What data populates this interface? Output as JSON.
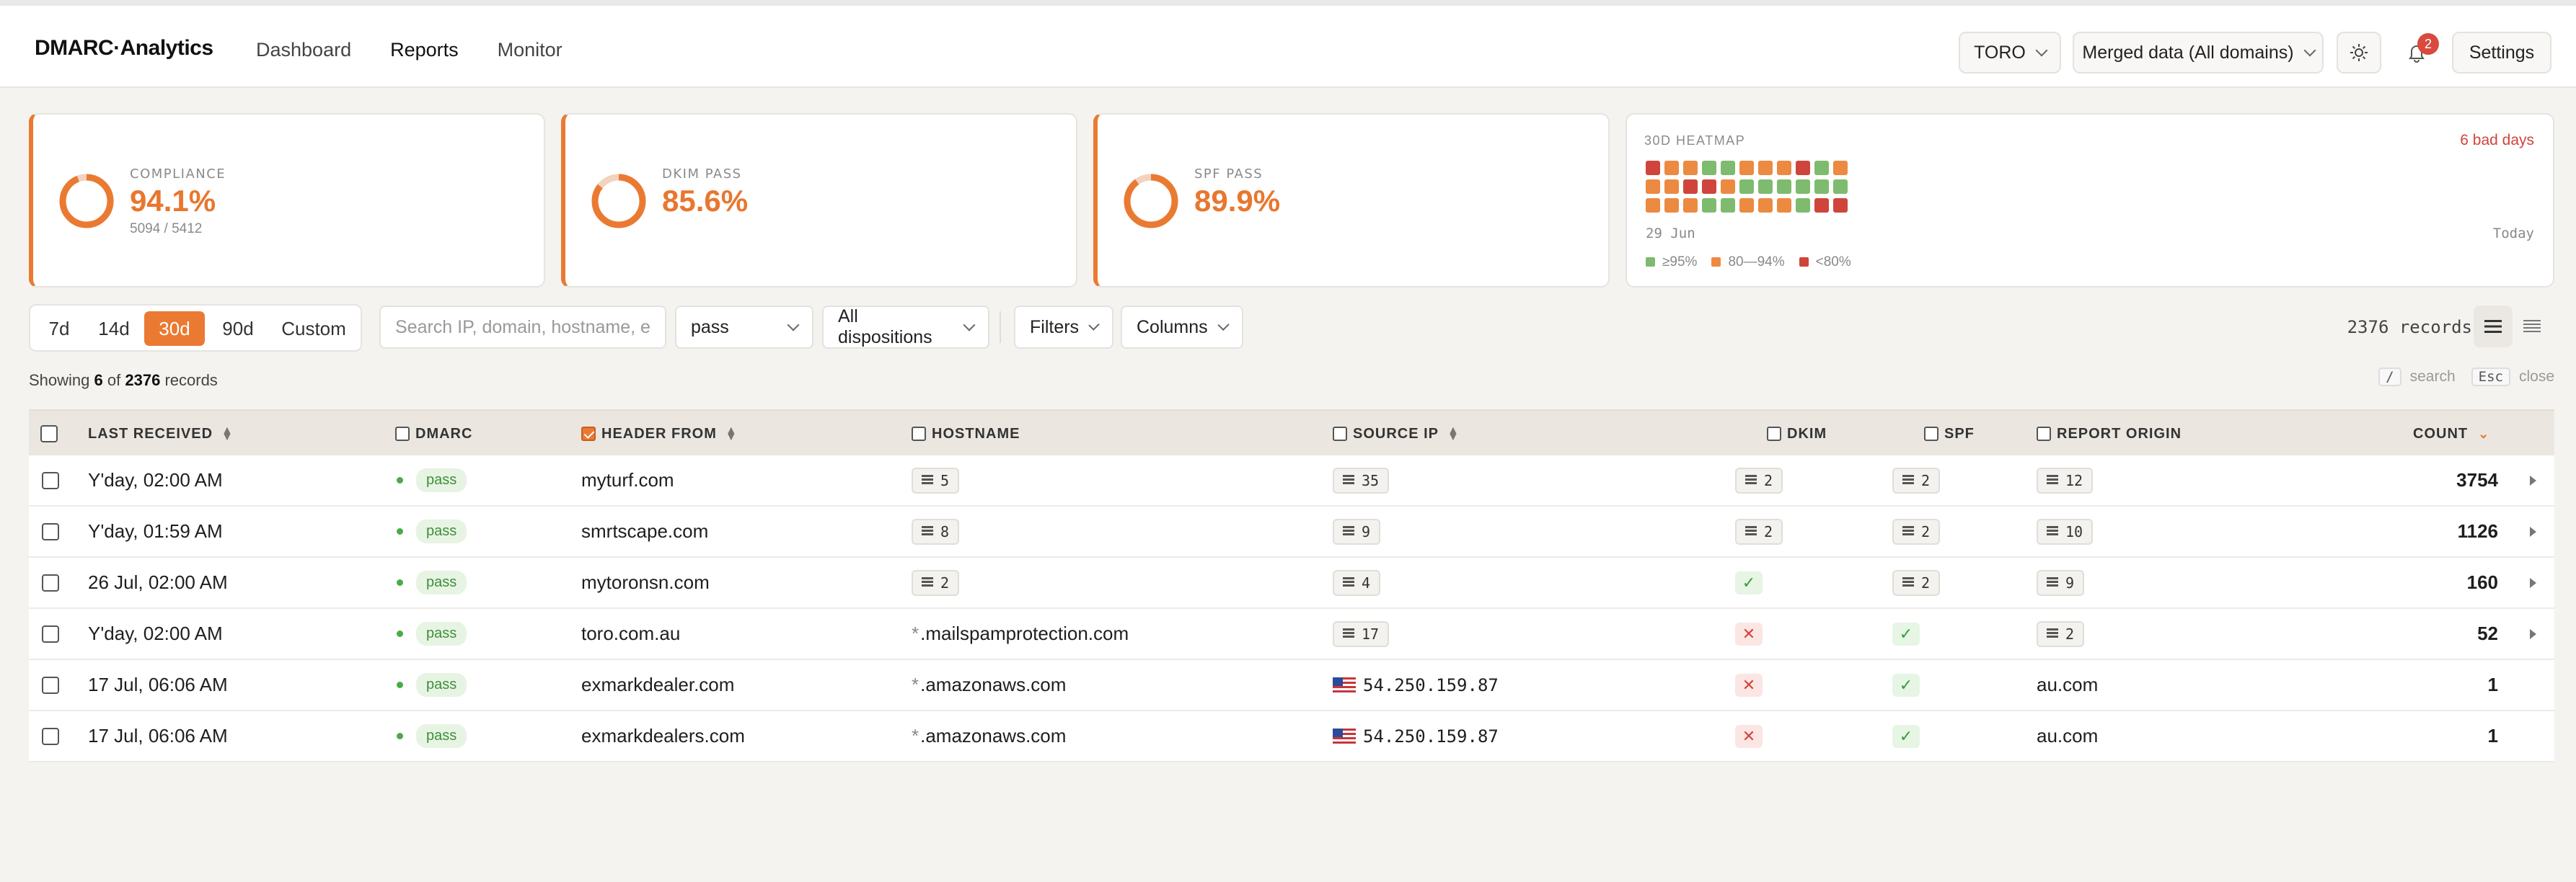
{
  "app": {
    "brand": "DMARC·Analytics"
  },
  "nav": [
    {
      "label": "Dashboard"
    },
    {
      "label": "Reports"
    },
    {
      "label": "Monitor"
    }
  ],
  "topbar": {
    "org_select": "TORO",
    "data_select": "Merged data (All domains)",
    "notif_count": "2",
    "settings_label": "Settings"
  },
  "kpis": [
    {
      "label": "COMPLIANCE",
      "value": "94.1%",
      "sub": "5094 / 5412",
      "percent": 94.1
    },
    {
      "label": "DKIM PASS",
      "value": "85.6%",
      "sub": "",
      "percent": 85.6
    },
    {
      "label": "SPF PASS",
      "value": "89.9%",
      "sub": "",
      "percent": 89.9
    }
  ],
  "heatmap": {
    "title": "30D HEATMAP",
    "bad_days": "6 bad days",
    "start_label": "29 Jun",
    "end_label": "Today",
    "legend": [
      "≥95%",
      "80—94%",
      "<80%"
    ],
    "colors": {
      "good": "#7fbb6e",
      "mid": "#ec8a42",
      "bad": "#d0453b"
    },
    "rows": [
      [
        "bad",
        "mid",
        "mid",
        "good",
        "good",
        "mid",
        "mid",
        "mid",
        "bad",
        "good",
        "mid"
      ],
      [
        "mid",
        "mid",
        "bad",
        "bad",
        "mid",
        "good",
        "good",
        "good",
        "good",
        "good",
        "good"
      ],
      [
        "mid",
        "mid",
        "mid",
        "good",
        "good",
        "mid",
        "mid",
        "mid",
        "good",
        "bad",
        "bad"
      ]
    ]
  },
  "filters": {
    "ranges": [
      "7d",
      "14d",
      "30d",
      "90d",
      "Custom"
    ],
    "active_range": "30d",
    "search_placeholder": "Search IP, domain, hostname, e",
    "result_select": "pass",
    "disposition_select": "All dispositions",
    "filters_label": "Filters",
    "columns_label": "Columns",
    "records_label": "2376 records"
  },
  "summary": {
    "prefix": "Showing",
    "shown": "6",
    "mid": "of",
    "total": "2376",
    "suffix": "records",
    "hint_search_key": "/",
    "hint_search": "search",
    "hint_close_key": "Esc",
    "hint_close": "close"
  },
  "table": {
    "columns": {
      "last_received": "LAST RECEIVED",
      "dmarc": "DMARC",
      "header_from": "HEADER FROM",
      "hostname": "HOSTNAME",
      "source_ip": "SOURCE IP",
      "dkim": "DKIM",
      "spf": "SPF",
      "report_origin": "REPORT ORIGIN",
      "count": "COUNT"
    },
    "rows": [
      {
        "received": "Y'day, 02:00 AM",
        "dmarc": "pass",
        "from": "myturf.com",
        "hostname": {
          "kind": "chip",
          "text": "5"
        },
        "ip": {
          "kind": "chip",
          "text": "35"
        },
        "dkim": {
          "kind": "chip",
          "text": "2"
        },
        "spf": {
          "kind": "chip",
          "text": "2"
        },
        "origin": {
          "kind": "chip",
          "text": "12"
        },
        "count": "3754",
        "expand": true
      },
      {
        "received": "Y'day, 01:59 AM",
        "dmarc": "pass",
        "from": "smrtscape.com",
        "hostname": {
          "kind": "chip",
          "text": "8"
        },
        "ip": {
          "kind": "chip",
          "text": "9"
        },
        "dkim": {
          "kind": "chip",
          "text": "2"
        },
        "spf": {
          "kind": "chip",
          "text": "2"
        },
        "origin": {
          "kind": "chip",
          "text": "10"
        },
        "count": "1126",
        "expand": true
      },
      {
        "received": "26 Jul, 02:00 AM",
        "dmarc": "pass",
        "from": "mytoronsn.com",
        "hostname": {
          "kind": "chip",
          "text": "2"
        },
        "ip": {
          "kind": "chip",
          "text": "4"
        },
        "dkim": {
          "kind": "ok",
          "text": "✓"
        },
        "spf": {
          "kind": "chip",
          "text": "2"
        },
        "origin": {
          "kind": "chip",
          "text": "9"
        },
        "count": "160",
        "expand": true
      },
      {
        "received": "Y'day, 02:00 AM",
        "dmarc": "pass",
        "from": "toro.com.au",
        "hostname": {
          "kind": "wild",
          "star": "*",
          "text": ".mailspamprotection.com"
        },
        "ip": {
          "kind": "chip",
          "text": "17"
        },
        "dkim": {
          "kind": "fail",
          "text": "✕"
        },
        "spf": {
          "kind": "ok",
          "text": "✓"
        },
        "origin": {
          "kind": "chip",
          "text": "2"
        },
        "count": "52",
        "expand": true
      },
      {
        "received": "17 Jul, 06:06 AM",
        "dmarc": "pass",
        "from": "exmarkdealer.com",
        "hostname": {
          "kind": "wild",
          "star": "*",
          "text": ".amazonaws.com"
        },
        "ip": {
          "kind": "ip",
          "text": "54.250.159.87"
        },
        "dkim": {
          "kind": "fail",
          "text": "✕"
        },
        "spf": {
          "kind": "ok",
          "text": "✓"
        },
        "origin": {
          "kind": "text",
          "text": "au.com"
        },
        "count": "1",
        "expand": false
      },
      {
        "received": "17 Jul, 06:06 AM",
        "dmarc": "pass",
        "from": "exmarkdealers.com",
        "hostname": {
          "kind": "wild",
          "star": "*",
          "text": ".amazonaws.com"
        },
        "ip": {
          "kind": "ip",
          "text": "54.250.159.87"
        },
        "dkim": {
          "kind": "fail",
          "text": "✕"
        },
        "spf": {
          "kind": "ok",
          "text": "✓"
        },
        "origin": {
          "kind": "text",
          "text": "au.com"
        },
        "count": "1",
        "expand": false
      }
    ]
  },
  "accent": "#ea7a32"
}
